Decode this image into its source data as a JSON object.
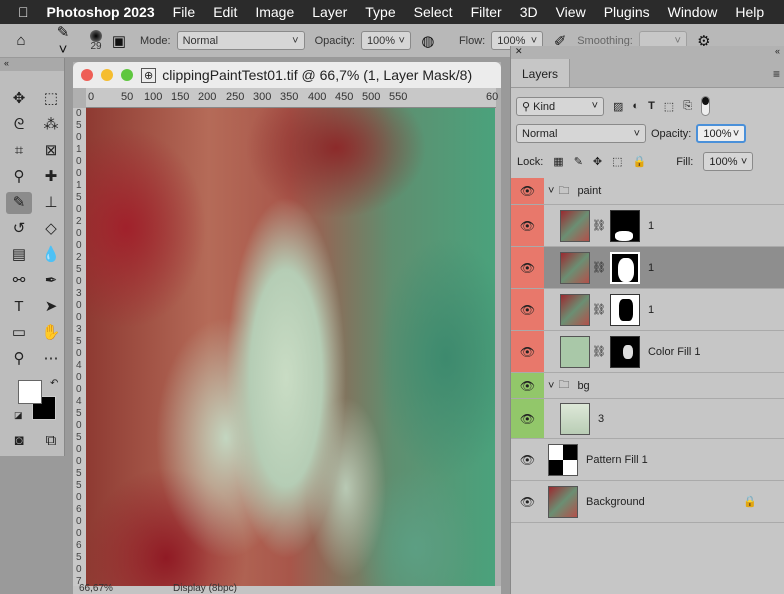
{
  "menubar": {
    "apple": "",
    "items": [
      "Photoshop 2023",
      "File",
      "Edit",
      "Image",
      "Layer",
      "Type",
      "Select",
      "Filter",
      "3D",
      "View",
      "Plugins",
      "Window",
      "Help"
    ]
  },
  "options": {
    "brush_size": "29",
    "mode_label": "Mode:",
    "mode_value": "Normal",
    "opacity_label": "Opacity:",
    "opacity_value": "100%",
    "flow_label": "Flow:",
    "flow_value": "100%",
    "smoothing_label": "Smoothing:",
    "smoothing_value": ""
  },
  "document": {
    "title": "clippingPaintTest01.tif @ 66,7% (1, Layer Mask/8)",
    "ruler_h": [
      "0",
      "50",
      "100",
      "150",
      "200",
      "250",
      "300",
      "350",
      "400",
      "450",
      "500",
      "550",
      "60"
    ],
    "ruler_v": [
      "0",
      "5",
      "0",
      "1",
      "0",
      "0",
      "1",
      "5",
      "0",
      "2",
      "0",
      "0",
      "2",
      "5",
      "0",
      "3",
      "0",
      "0",
      "3",
      "5",
      "0",
      "4",
      "0",
      "0",
      "4",
      "5",
      "0",
      "5",
      "0",
      "0",
      "5",
      "5",
      "0",
      "6",
      "0",
      "0",
      "6",
      "5",
      "0",
      "7"
    ],
    "zoom": "66,67%",
    "status_info": "Display (8bpc)"
  },
  "layers_panel": {
    "tab": "Layers",
    "filter_kind": "Kind",
    "blend_mode": "Normal",
    "opacity_label": "Opacity:",
    "opacity_value": "100%",
    "lock_label": "Lock:",
    "fill_label": "Fill:",
    "fill_value": "100%",
    "colors": {
      "paint": "#e8786b",
      "bg": "#92c76a",
      "selected": "#8e8e8e"
    },
    "layers": [
      {
        "name": "paint",
        "type": "group"
      },
      {
        "name": "1",
        "type": "masked"
      },
      {
        "name": "1",
        "type": "masked",
        "selected": true
      },
      {
        "name": "1",
        "type": "masked"
      },
      {
        "name": "Color Fill 1",
        "type": "fill"
      },
      {
        "name": "bg",
        "type": "group"
      },
      {
        "name": "3",
        "type": "smart"
      },
      {
        "name": "Pattern Fill 1",
        "type": "pattern"
      },
      {
        "name": "Background",
        "type": "background",
        "locked": true
      }
    ]
  }
}
